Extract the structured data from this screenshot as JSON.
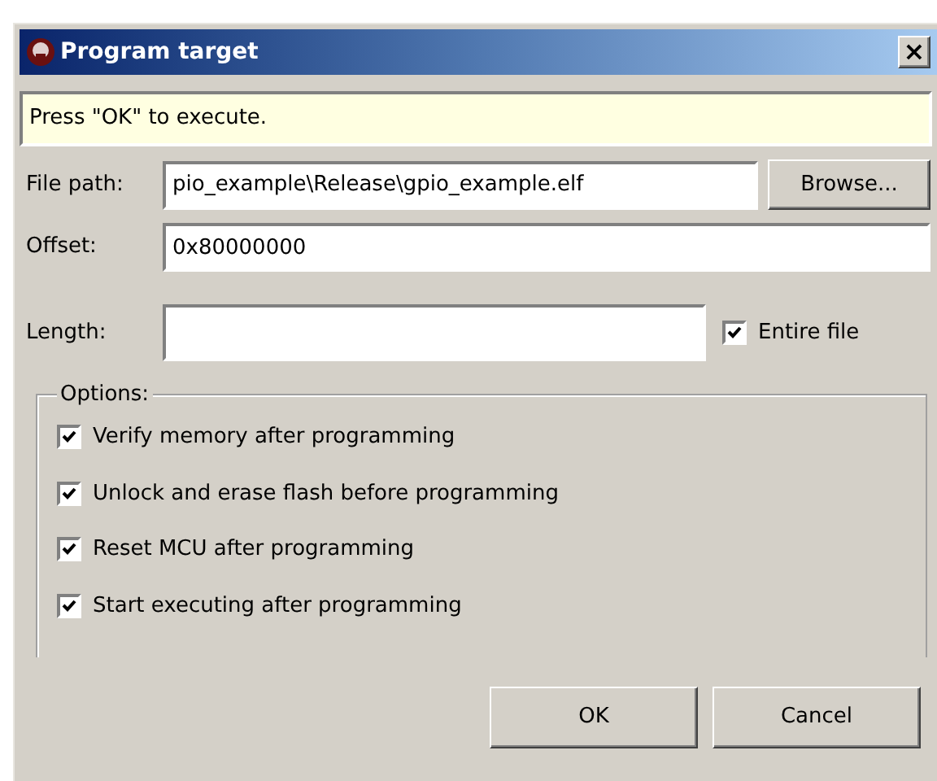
{
  "window": {
    "title": "Program target",
    "close": "×"
  },
  "message": "Press \"OK\" to execute.",
  "file_path": {
    "label": "File path:",
    "value": "pio_example\\Release\\gpio_example.elf",
    "button": "Browse..."
  },
  "offset": {
    "label": "Offset:",
    "value": "0x80000000"
  },
  "length": {
    "label": "Length:",
    "entire_file": {
      "label": "Entire file",
      "checked": true
    }
  },
  "options": {
    "title": "Options:",
    "items": [
      {
        "label": "Verify memory after programming",
        "checked": true
      },
      {
        "label": "Unlock and erase flash before programming",
        "checked": true
      },
      {
        "label": "Reset MCU after programming",
        "checked": true
      },
      {
        "label": "Start executing after programming",
        "checked": true
      }
    ]
  },
  "buttons": [
    "OK",
    "Cancel"
  ]
}
